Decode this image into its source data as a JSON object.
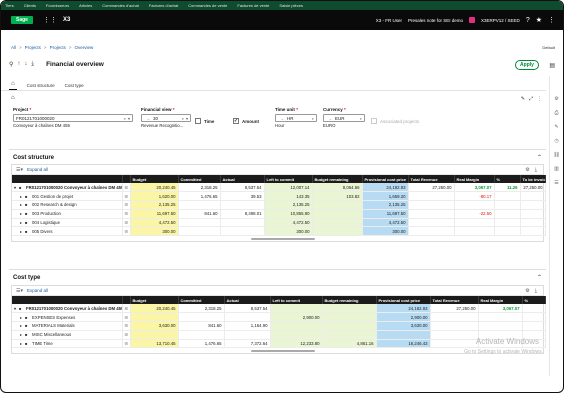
{
  "topnav": [
    "Tiers",
    "Clients",
    "Fournisseurs",
    "Articles",
    "Commandes d'achat",
    "Factures d'achat",
    "Commandes de vente",
    "Factures de vente",
    "Saisie pièces"
  ],
  "header": {
    "logo": "Sage",
    "product": "X3",
    "user": "X3 - FR User",
    "folder": "Presales note for SEI demo",
    "endpoint": "X3ERPV12 / SEED"
  },
  "breadcrumb": [
    "All",
    "Projects",
    "Projects",
    "Overview"
  ],
  "default_label": "Default",
  "title": "Financial overview",
  "apply_label": "Apply",
  "tabs": [
    "Cost structure",
    "Cost type"
  ],
  "params": {
    "project": {
      "label": "Project",
      "value": "FR0121701000020",
      "sub": "Convoyeur à chaînes DM 455"
    },
    "financial_view": {
      "label": "Financial view",
      "value": "30",
      "sub": "Revenue Recognitio..."
    },
    "time_check": {
      "label": "Time",
      "checked": false
    },
    "amount_check": {
      "label": "Amount",
      "checked": true
    },
    "time_unit": {
      "label": "Time unit",
      "value": "HR",
      "sub": "Hour"
    },
    "currency": {
      "label": "Currency",
      "value": "EUR",
      "sub": "EURO"
    },
    "associated_projects": {
      "label": "Associated projects",
      "checked": false
    }
  },
  "cost_structure": {
    "title": "Cost structure",
    "expand_all": "Expand all",
    "columns": [
      "",
      "",
      "Budget",
      "Committed",
      "Actual",
      "Left to commit",
      "Budget remaining",
      "Provisional cost price",
      "Total Revenue",
      "Real Margin",
      "%",
      "To be invoiced"
    ],
    "rows": [
      {
        "level": 0,
        "label": "FR0121701000020 Convoyeur à chaînes DM 455",
        "budget": "20,240.45",
        "committed": "2,318.25",
        "actual": "8,537.54",
        "left": "12,007.14",
        "remaining": "8,064.66",
        "pcp": "24,182.93",
        "revenue": "27,250.00",
        "margin": "3,067.07",
        "pct": "11.26",
        "tbi": "27,250.00"
      },
      {
        "level": 1,
        "label": "001 Gestion de projet",
        "budget": "1,620.00",
        "committed": "1,476.65",
        "actual": "39.53",
        "left": "143.35",
        "remaining": "103.82",
        "pcp": "1,659.20",
        "revenue": "",
        "margin": "-80.17",
        "pct": "",
        "tbi": ""
      },
      {
        "level": 1,
        "label": "002 Research & design",
        "budget": "2,135.25",
        "committed": "",
        "actual": "",
        "left": "2,135.25",
        "remaining": "",
        "pcp": "2,135.25",
        "revenue": "",
        "margin": "",
        "pct": "",
        "tbi": ""
      },
      {
        "level": 1,
        "label": "003 Production",
        "budget": "11,697.50",
        "committed": "841.60",
        "actual": "8,498.01",
        "left": "10,855.90",
        "remaining": "",
        "pcp": "11,697.50",
        "revenue": "",
        "margin": "-22.50",
        "pct": "",
        "tbi": ""
      },
      {
        "level": 1,
        "label": "004 Logistique",
        "budget": "4,472.50",
        "committed": "",
        "actual": "",
        "left": "4,472.50",
        "remaining": "",
        "pcp": "4,472.50",
        "revenue": "",
        "margin": "",
        "pct": "",
        "tbi": ""
      },
      {
        "level": 1,
        "label": "005 Divers",
        "budget": "300.00",
        "committed": "",
        "actual": "",
        "left": "300.00",
        "remaining": "",
        "pcp": "300.00",
        "revenue": "",
        "margin": "",
        "pct": "",
        "tbi": ""
      }
    ]
  },
  "cost_type": {
    "title": "Cost type",
    "expand_all": "Expand all",
    "columns": [
      "",
      "",
      "Budget",
      "Committed",
      "Actual",
      "Left to commit",
      "Budget remaining",
      "Provisional cost price",
      "Total Revenue",
      "Real Margin",
      "%"
    ],
    "rows": [
      {
        "level": 0,
        "label": "FR0121701000020 Convoyeur à chaînes DM 455",
        "budget": "20,240.45",
        "committed": "2,318.25",
        "actual": "8,537.54",
        "left": "",
        "remaining": "",
        "pcp": "24,182.93",
        "revenue": "27,250.00",
        "margin": "3,067.07",
        "pct": ""
      },
      {
        "level": 1,
        "label": "EXPENSES Expenses",
        "budget": "",
        "committed": "",
        "actual": "",
        "left": "2,900.00",
        "remaining": "",
        "pcp": "2,900.00",
        "revenue": "",
        "margin": "",
        "pct": ""
      },
      {
        "level": 1,
        "label": "MATERIALS Materials",
        "budget": "3,630.00",
        "committed": "841.60",
        "actual": "1,164.90",
        "left": "",
        "remaining": "",
        "pcp": "3,630.00",
        "revenue": "",
        "margin": "",
        "pct": ""
      },
      {
        "level": 1,
        "label": "MISC Miscellaneous",
        "budget": "",
        "committed": "",
        "actual": "",
        "left": "",
        "remaining": "",
        "pcp": "",
        "revenue": "",
        "margin": "",
        "pct": ""
      },
      {
        "level": 1,
        "label": "TIME Time",
        "budget": "13,710.45",
        "committed": "1,476.65",
        "actual": "7,372.64",
        "left": "12,233.80",
        "remaining": "4,861.16",
        "pcp": "16,246.43",
        "revenue": "",
        "margin": "",
        "pct": ""
      }
    ]
  },
  "watermark": {
    "line1": "Activate Windows",
    "line2": "Go to Settings to activate Windows."
  }
}
